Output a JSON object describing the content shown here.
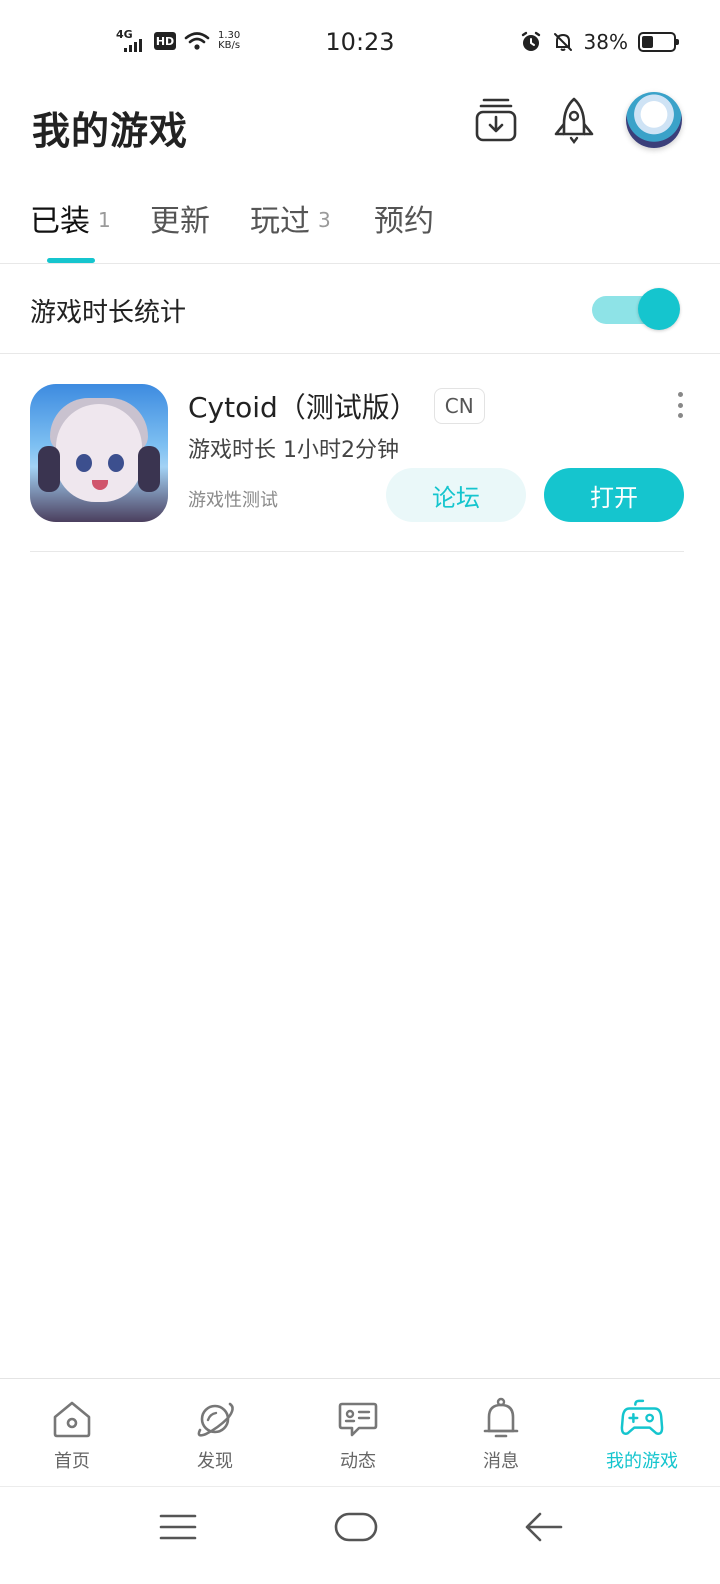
{
  "status_bar": {
    "network": "4G",
    "hd": "HD",
    "speed_value": "1.30",
    "speed_unit": "KB/s",
    "time": "10:23",
    "battery_percent": "38%",
    "battery_level": 0.38
  },
  "header": {
    "title": "我的游戏",
    "icons": [
      "download-manager-icon",
      "rocket-icon",
      "user-avatar"
    ]
  },
  "tabs": [
    {
      "label": "已装",
      "count": "1",
      "active": true
    },
    {
      "label": "更新",
      "count": ""
    },
    {
      "label": "玩过",
      "count": "3"
    },
    {
      "label": "预约",
      "count": ""
    }
  ],
  "stats": {
    "label": "游戏时长统计",
    "enabled": true
  },
  "game": {
    "name": "Cytoid（测试版）",
    "region": "CN",
    "playtime": "游戏时长 1小时2分钟",
    "status": "游戏性测试",
    "forum_label": "论坛",
    "open_label": "打开"
  },
  "bottom_nav": [
    {
      "label": "首页",
      "icon": "home-icon"
    },
    {
      "label": "发现",
      "icon": "planet-icon"
    },
    {
      "label": "动态",
      "icon": "feed-icon"
    },
    {
      "label": "消息",
      "icon": "bell-icon"
    },
    {
      "label": "我的游戏",
      "icon": "gamepad-icon",
      "active": true
    }
  ],
  "colors": {
    "accent": "#15c5ce",
    "accent_light": "#eaf8f9",
    "toggle_track": "#8ee3e7"
  }
}
